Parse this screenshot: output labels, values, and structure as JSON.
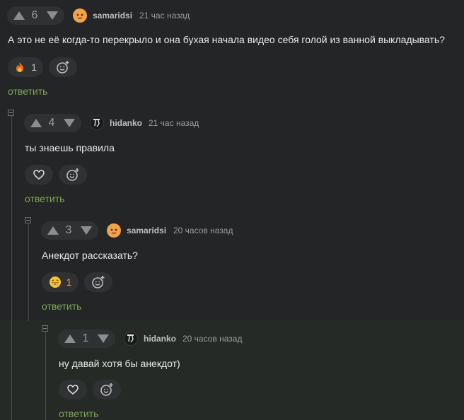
{
  "comments": [
    {
      "votes": "6",
      "author": "samaridsi",
      "time": "21 час назад",
      "text": "А это не её когда-то перекрыло и она бухая начала видео себя голой из ванной выкладывать?",
      "reaction_count": "1",
      "reply": "ответить"
    },
    {
      "votes": "4",
      "author": "hidanko",
      "time": "21 час назад",
      "text": "ты знаешь правила",
      "reply": "ответить"
    },
    {
      "votes": "3",
      "author": "samaridsi",
      "time": "20 часов назад",
      "text": "Анекдот рассказать?",
      "reaction_count": "1",
      "reply": "ответить"
    },
    {
      "votes": "1",
      "author": "hidanko",
      "time": "20 часов назад",
      "text": "ну давай хотя бы анекдот)",
      "reply": "ответить"
    }
  ],
  "icons": {
    "fire": "fire-icon",
    "laugh": "laughing-emoji-icon",
    "heart": "heart-icon",
    "add_reaction": "add-reaction-icon"
  },
  "colors": {
    "background": "#242526",
    "highlight": "#262a27",
    "reply": "#7fa654",
    "pill": "#303133"
  }
}
